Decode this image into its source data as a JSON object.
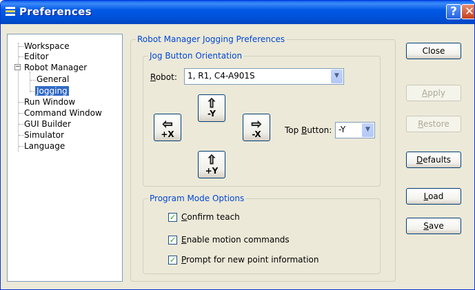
{
  "window": {
    "title": "Preferences"
  },
  "tree": {
    "items": [
      {
        "label": "Workspace"
      },
      {
        "label": "Editor"
      },
      {
        "label": "Robot Manager"
      },
      {
        "label": "General"
      },
      {
        "label": "Jogging"
      },
      {
        "label": "Run Window"
      },
      {
        "label": "Command Window"
      },
      {
        "label": "GUI Builder"
      },
      {
        "label": "Simulator"
      },
      {
        "label": "Language"
      }
    ],
    "expander_symbol": "−"
  },
  "jogging_group": {
    "title": "Robot Manager Jogging Preferences",
    "orientation_group": {
      "title": "Jog Button Orientation",
      "robot_label_underlined": "R",
      "robot_label_rest": "obot:",
      "robot_value": "1, R1, C4-A901S",
      "buttons": {
        "up": "-Y",
        "left": "+X",
        "right": "-X",
        "down": "+Y"
      },
      "top_button_label_pre": "Top ",
      "top_button_label_u": "B",
      "top_button_label_post": "utton:",
      "top_button_value": "-Y"
    },
    "program_mode_group": {
      "title": "Program Mode Options",
      "options": [
        {
          "u": "C",
          "rest": "onfirm teach",
          "checked": true
        },
        {
          "u": "E",
          "rest": "nable motion commands",
          "checked": true
        },
        {
          "u": "P",
          "rest": "rompt for new point information",
          "checked": true
        }
      ]
    }
  },
  "buttons": {
    "close": "Close",
    "apply_u": "A",
    "apply_rest": "pply",
    "restore_u": "R",
    "restore_rest": "estore",
    "defaults_u": "D",
    "defaults_rest": "efaults",
    "load_u": "L",
    "load_rest": "oad",
    "save_u": "S",
    "save_rest": "ave"
  },
  "colors": {
    "titlebar": "#0054E3",
    "group_title": "#0046D5",
    "selection": "#316AC5",
    "dialog_bg": "#ECE9D8"
  }
}
